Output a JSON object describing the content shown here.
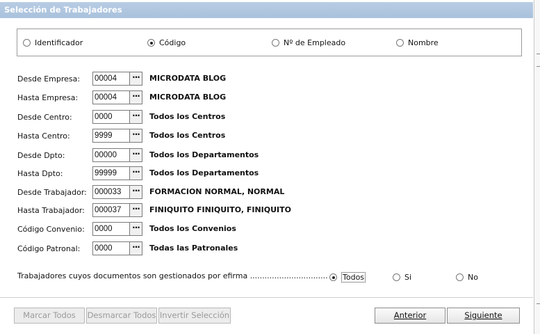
{
  "window": {
    "title": "Selección de Trabajadores"
  },
  "order": {
    "options": [
      {
        "label": "Identificador",
        "selected": false
      },
      {
        "label": "Código",
        "selected": true
      },
      {
        "label": "Nº de Empleado",
        "selected": false
      },
      {
        "label": "Nombre",
        "selected": false
      }
    ]
  },
  "filters": [
    {
      "label": "Desde Empresa:",
      "code": "00004",
      "desc": "MICRODATA BLOG"
    },
    {
      "label": "Hasta Empresa:",
      "code": "00004",
      "desc": "MICRODATA BLOG"
    },
    {
      "label": "Desde Centro:",
      "code": "0000",
      "desc": "Todos los Centros"
    },
    {
      "label": "Hasta Centro:",
      "code": "9999",
      "desc": "Todos los Centros"
    },
    {
      "label": "Desde Dpto:",
      "code": "00000",
      "desc": "Todos los Departamentos"
    },
    {
      "label": "Hasta Dpto:",
      "code": "99999",
      "desc": "Todos los Departamentos"
    },
    {
      "label": "Desde Trabajador:",
      "code": "000033",
      "desc": "FORMACION NORMAL, NORMAL"
    },
    {
      "label": "Hasta Trabajador:",
      "code": "000037",
      "desc": "FINIQUITO FINIQUITO, FINIQUITO"
    },
    {
      "label": "Código Convenio:",
      "code": "0000",
      "desc": "Todos los Convenios"
    },
    {
      "label": "Código Patronal:",
      "code": "0000",
      "desc": "Todas las Patronales"
    }
  ],
  "ellipsis": "···",
  "efirma": {
    "label": "Trabajadores cuyos documentos son gestionados por efirma ................................",
    "options": [
      {
        "label": "Todos",
        "selected": true
      },
      {
        "label": "Si",
        "selected": false
      },
      {
        "label": "No",
        "selected": false
      }
    ]
  },
  "buttons": {
    "mark_all": "Marcar Todos",
    "unmark_all": "Desmarcar Todos",
    "invert": "Invertir Selección",
    "previous": "Anterior",
    "next": "Siguiente"
  }
}
